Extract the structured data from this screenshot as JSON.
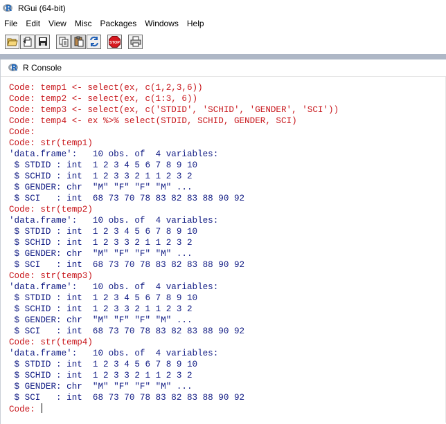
{
  "window": {
    "title": "RGui (64-bit)"
  },
  "menu": {
    "items": [
      "File",
      "Edit",
      "View",
      "Misc",
      "Packages",
      "Windows",
      "Help"
    ]
  },
  "toolbar": {
    "buttons": [
      "open-script-icon",
      "load-workspace-icon",
      "save-workspace-icon",
      "copy-icon",
      "paste-icon",
      "copy-paste-icon",
      "stop-icon",
      "print-icon"
    ],
    "stop_label": "STOP"
  },
  "console": {
    "title": "R Console",
    "lines": [
      {
        "type": "cmd",
        "text": "Code: temp1 <- select(ex, c(1,2,3,6))"
      },
      {
        "type": "cmd",
        "text": "Code: temp2 <- select(ex, c(1:3, 6))"
      },
      {
        "type": "cmd",
        "text": "Code: temp3 <- select(ex, c('STDID', 'SCHID', 'GENDER', 'SCI'))"
      },
      {
        "type": "cmd",
        "text": "Code: temp4 <- ex %>% select(STDID, SCHID, GENDER, SCI)"
      },
      {
        "type": "cmd",
        "text": "Code:"
      },
      {
        "type": "cmd",
        "text": "Code: str(temp1)"
      },
      {
        "type": "out",
        "text": "'data.frame':   10 obs. of  4 variables:"
      },
      {
        "type": "out",
        "text": " $ STDID : int  1 2 3 4 5 6 7 8 9 10"
      },
      {
        "type": "out",
        "text": " $ SCHID : int  1 2 3 3 2 1 1 2 3 2"
      },
      {
        "type": "out",
        "text": " $ GENDER: chr  \"M\" \"F\" \"F\" \"M\" ..."
      },
      {
        "type": "out",
        "text": " $ SCI   : int  68 73 70 78 83 82 83 88 90 92"
      },
      {
        "type": "cmd",
        "text": "Code: str(temp2)"
      },
      {
        "type": "out",
        "text": "'data.frame':   10 obs. of  4 variables:"
      },
      {
        "type": "out",
        "text": " $ STDID : int  1 2 3 4 5 6 7 8 9 10"
      },
      {
        "type": "out",
        "text": " $ SCHID : int  1 2 3 3 2 1 1 2 3 2"
      },
      {
        "type": "out",
        "text": " $ GENDER: chr  \"M\" \"F\" \"F\" \"M\" ..."
      },
      {
        "type": "out",
        "text": " $ SCI   : int  68 73 70 78 83 82 83 88 90 92"
      },
      {
        "type": "cmd",
        "text": "Code: str(temp3)"
      },
      {
        "type": "out",
        "text": "'data.frame':   10 obs. of  4 variables:"
      },
      {
        "type": "out",
        "text": " $ STDID : int  1 2 3 4 5 6 7 8 9 10"
      },
      {
        "type": "out",
        "text": " $ SCHID : int  1 2 3 3 2 1 1 2 3 2"
      },
      {
        "type": "out",
        "text": " $ GENDER: chr  \"M\" \"F\" \"F\" \"M\" ..."
      },
      {
        "type": "out",
        "text": " $ SCI   : int  68 73 70 78 83 82 83 88 90 92"
      },
      {
        "type": "cmd",
        "text": "Code: str(temp4)"
      },
      {
        "type": "out",
        "text": "'data.frame':   10 obs. of  4 variables:"
      },
      {
        "type": "out",
        "text": " $ STDID : int  1 2 3 4 5 6 7 8 9 10"
      },
      {
        "type": "out",
        "text": " $ SCHID : int  1 2 3 3 2 1 1 2 3 2"
      },
      {
        "type": "out",
        "text": " $ GENDER: chr  \"M\" \"F\" \"F\" \"M\" ..."
      },
      {
        "type": "out",
        "text": " $ SCI   : int  68 73 70 78 83 82 83 88 90 92"
      }
    ],
    "prompt": "Code: ",
    "colors": {
      "command": "#c8171c",
      "output": "#0f1a83",
      "mdi_background": "#aeb7c6"
    }
  }
}
